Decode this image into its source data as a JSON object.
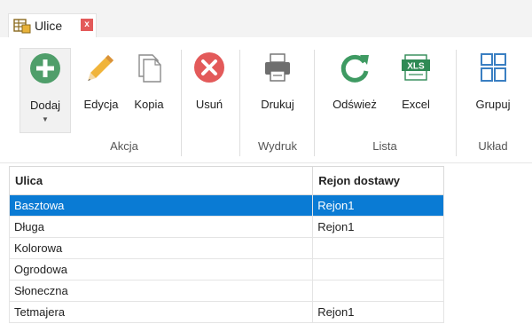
{
  "tab": {
    "title": "Ulice",
    "close": "x"
  },
  "ribbon": {
    "buttons": {
      "add": "Dodaj",
      "edit": "Edycja",
      "copy": "Kopia",
      "delete": "Usuń",
      "print": "Drukuj",
      "refresh": "Odśwież",
      "excel": "Excel",
      "group": "Grupuj"
    },
    "groups": {
      "action": "Akcja",
      "print": "Wydruk",
      "list": "Lista",
      "layout": "Układ"
    },
    "icons": [
      "add-circle-icon",
      "pencil-icon",
      "copy-icon",
      "delete-circle-icon",
      "printer-icon",
      "refresh-icon",
      "excel-xls-icon",
      "group-icon"
    ],
    "colors": {
      "add": "#4f9e6a",
      "delete": "#e35a5a",
      "refresh": "#3e9a62",
      "excel": "#2f8a55",
      "group": "#3a7fc2"
    }
  },
  "grid": {
    "columns": [
      "Ulica",
      "Rejon dostawy"
    ],
    "rows": [
      {
        "street": "Basztowa",
        "region": "Rejon1",
        "selected": true
      },
      {
        "street": "Długa",
        "region": "Rejon1"
      },
      {
        "street": "Kolorowa",
        "region": ""
      },
      {
        "street": "Ogrodowa",
        "region": ""
      },
      {
        "street": "Słoneczna",
        "region": ""
      },
      {
        "street": "Tetmajera",
        "region": "Rejon1"
      }
    ],
    "selection_color": "#0a7bd4"
  }
}
